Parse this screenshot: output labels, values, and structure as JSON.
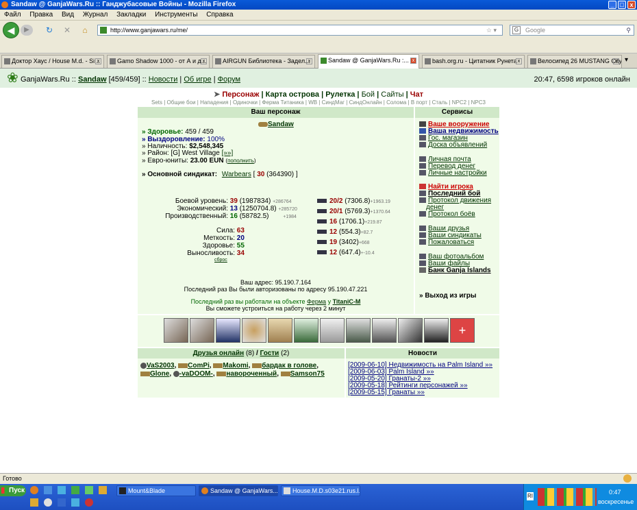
{
  "window": {
    "title": "Sandaw @ GanjaWars.Ru :: Ганджубасовые Войны - Mozilla Firefox"
  },
  "menu": [
    "Файл",
    "Правка",
    "Вид",
    "Журнал",
    "Закладки",
    "Инструменты",
    "Справка"
  ],
  "url": "http://www.ganjawars.ru/me/",
  "search_placeholder": "Google",
  "tabs": [
    "Доктор Хаус / House M.d. - Si...",
    "Gamo Shadow 1000 - от А и д...",
    "AIRGUN Библиотека - Задел...",
    "Sandaw @ GanjaWars.Ru :...",
    "bash.org.ru - Цитатник Рунета",
    "Велосипед 26 MUSTANG City ..."
  ],
  "header": {
    "site": "GanjaWars.Ru",
    "sep": "::",
    "user": "Sandaw",
    "hp": "[459/459]",
    "news": "Новости",
    "about": "Об игре",
    "forum": "Форум",
    "right": "20:47, 6598 игроков онлайн"
  },
  "mainnav": {
    "persona": "Персонаж",
    "map": "Карта острова",
    "roulette": "Рулетка",
    "fight": "Бой",
    "sites": "Сайты",
    "chat": "Чат"
  },
  "subnav": "Sets | Общие бои | Нападения | Одиночки | Ферма Титаника | WB | СиндМаг | СиндОнлайн | Солома | В порт | Сталь | NPC2 | NPC3",
  "char": {
    "title": "Ваш персонаж",
    "name": "Sandaw",
    "health_label": "» Здоровье:",
    "health": "459 / 459",
    "recovery_label": "» Выздоровление:",
    "recovery": "100%",
    "cash_label": "» Наличность:",
    "cash": "$2,548,345",
    "district_label": "» Район:",
    "district": "[G] West Village",
    "district_more": "[»»]",
    "euro_label": "» Евро-юниты:",
    "euro": "23.00 EUN",
    "euro_add": "пополнить",
    "syndicate_label": "» Основной синдикат:",
    "syndicate": "Warbears",
    "syndicate_num": "30",
    "syndicate_pts": "(364390) ]"
  },
  "levels": [
    {
      "label": "Боевой уровень:",
      "value": "39",
      "pts": "(1987834)",
      "plus": "+286764"
    },
    {
      "label": "Экономический:",
      "value": "13",
      "pts": "(1250704.8)",
      "plus": "+285720"
    },
    {
      "label": "Производственный:",
      "value": "16",
      "pts": "(58782.5)",
      "plus": "+1984"
    }
  ],
  "stats": [
    {
      "label": "Сила:",
      "value": "63"
    },
    {
      "label": "Меткость:",
      "value": "20"
    },
    {
      "label": "Здоровье:",
      "value": "55"
    },
    {
      "label": "Выносливость:",
      "value": "34"
    }
  ],
  "reset": "сброс",
  "weapons": [
    {
      "lvl": "20/2",
      "pts": "(7306.8)",
      "plus": "+1963.19"
    },
    {
      "lvl": "20/1",
      "pts": "(5769.3)",
      "plus": "+1370.64"
    },
    {
      "lvl": "16",
      "pts": "(1706.1)",
      "plus": "+219.87"
    },
    {
      "lvl": "12",
      "pts": "(554.3)",
      "plus": "+82.7"
    },
    {
      "lvl": "19",
      "pts": "(3402)",
      "plus": "+668"
    },
    {
      "lvl": "12",
      "pts": "(647.4)",
      "plus": "+-10.4"
    }
  ],
  "address": {
    "line1": "Ваш адрес: 95.190.7.164",
    "line2": "Последний раз Вы были авторизованы по адресу 95.190.47.221",
    "work_pre": "Последний раз вы работали на объекте",
    "work_obj": "Ферма",
    "work_at": "у",
    "work_owner": "TitaniC-M",
    "work_note": "Вы сможете устроиться на работу через 2 минут"
  },
  "services": {
    "title": "Сервисы",
    "items": [
      "Ваше вооружение",
      "Ваша недвижимость",
      "Гос. магазин",
      "Доска объявлений",
      "Личная почта",
      "Перевод денег",
      "Личные настройки",
      "Найти игрока",
      "Последний бой",
      "Протокол движения",
      "денег",
      "Протокол боёв",
      "Ваши друзья",
      "Ваши синдикаты",
      "Пожаловаться",
      "Ваш фотоальбом",
      "Ваши файлы",
      "Банк Ganja Islands"
    ],
    "exit": "» Выход из игры"
  },
  "friends": {
    "title": "Друзья онлайн",
    "count": "(8)",
    "slash": "/",
    "guests": "Гости",
    "gcount": "(2)",
    "row1": [
      "VaS2003",
      "ComPi",
      "Makomi",
      "бардак в голове"
    ],
    "row2": [
      "Glone",
      "-vaDOOM-",
      "навороченный",
      "Samson75"
    ]
  },
  "news": {
    "title": "Новости",
    "items": [
      "[2009-06-10] Недвижимость на Palm Island »»",
      "[2009-06-03] Palm Island »»",
      "[2009-05-20] Гранаты-2 »»",
      "[2009-05-18] Рейтинги персонажей »»",
      "[2009-05-15] Гранаты »»"
    ]
  },
  "status": "Готово",
  "taskbar": {
    "start": "Пуск",
    "tasks": [
      "Mount&Blade",
      "Sandaw @ GanjaWars...",
      "House.M.D.s03e21.rus.l..."
    ],
    "clock": "0:47",
    "day": "воскресенье"
  }
}
